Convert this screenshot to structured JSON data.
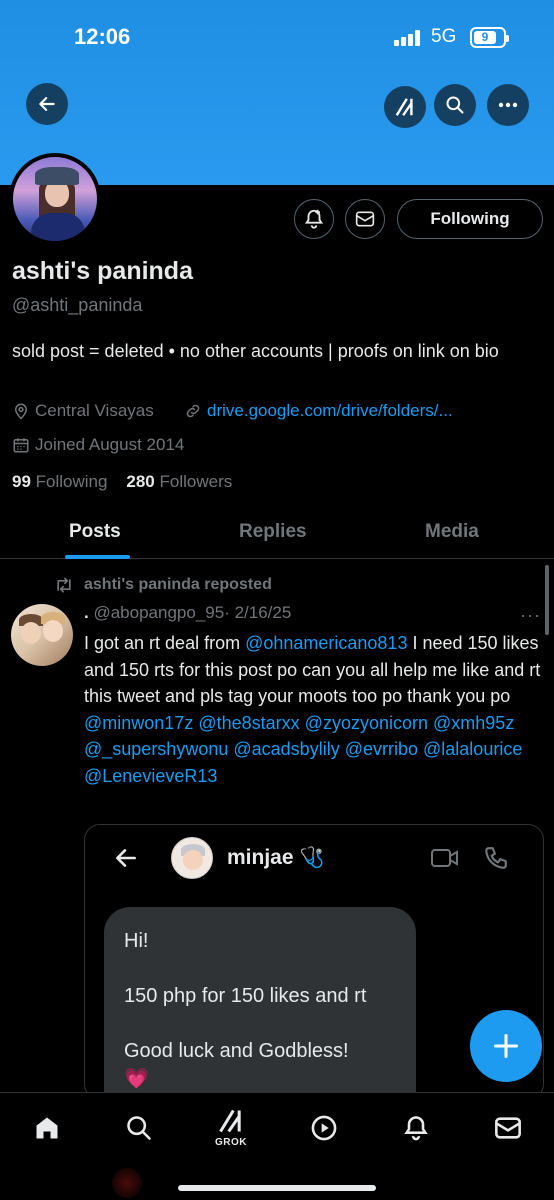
{
  "status_bar": {
    "time": "12:06",
    "network": "5G",
    "battery": "9"
  },
  "profile": {
    "name": "ashti's paninda",
    "handle": "@ashti_paninda",
    "bio": "sold post = deleted • no other accounts | proofs on link on bio",
    "location": "Central Visayas",
    "link": "drive.google.com/drive/folders/...",
    "joined": "Joined August 2014",
    "following_count": "99",
    "following_label": "Following",
    "followers_count": "280",
    "followers_label": "Followers",
    "follow_button": "Following"
  },
  "tabs": [
    {
      "label": "Posts",
      "active": true
    },
    {
      "label": "Replies",
      "active": false
    },
    {
      "label": "Media",
      "active": false
    }
  ],
  "post": {
    "repost_label": "ashti's paninda reposted",
    "author_dot": ".",
    "author_handle": "@abopangpo_95",
    "date": "· 2/16/25",
    "more": "···",
    "text_1": "I got an rt deal from ",
    "mention_1": "@ohnamericano813",
    "text_2": " I need 150 likes and 150 rts for this post po can you all help me like and rt this tweet and pls tag your moots too po thank you po ",
    "mentions": [
      "@minwon17z",
      "@the8starxx",
      "@zyozyonicorn",
      "@xmh95z",
      "@_supershywonu",
      "@acadsbylily",
      "@evrribo",
      "@lalalourice",
      "@LenevieveR13"
    ],
    "embed": {
      "contact_name": "minjae",
      "contact_emoji": "🩺",
      "message_lines": [
        "Hi!",
        "150 php for 150 likes and rt",
        "Good luck and Godbless!",
        "💗"
      ]
    }
  },
  "nav": {
    "grok_label": "GROK"
  },
  "colors": {
    "accent": "#1d9bf0",
    "banner": "#1e8fe2",
    "muted": "#71767b",
    "text": "#e7e9ea"
  }
}
